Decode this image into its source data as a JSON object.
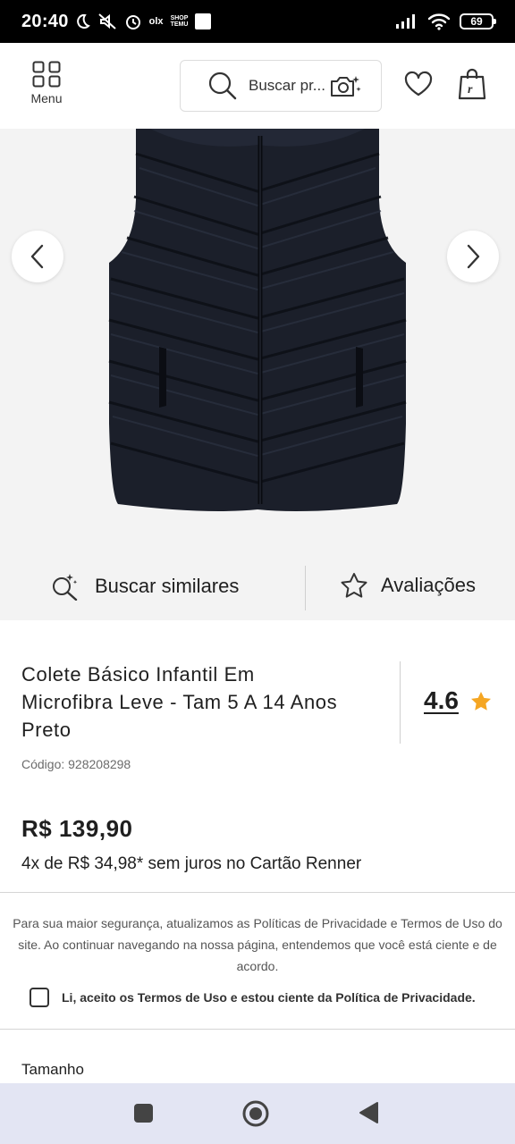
{
  "status_bar": {
    "time": "20:40",
    "olx": "olx",
    "temu_top": "SHOP",
    "temu_bottom": "TEMU",
    "battery": "69"
  },
  "header": {
    "menu_label": "Menu",
    "search_placeholder": "Buscar pr..."
  },
  "gallery": {
    "image_alt": "Colete preto acolchoado"
  },
  "actions": {
    "similar_label": "Buscar similares",
    "reviews_label": "Avaliações"
  },
  "product": {
    "title_line1": "Colete Básico Infantil Em",
    "title_line2": "Microfibra Leve - Tam 5 A 14 Anos",
    "title_line3": "Preto",
    "rating": "4.6",
    "code": "Código: 928208298",
    "price": "R$ 139,90",
    "installments": "4x de R$ 34,98* sem juros no Cartão Renner",
    "size_label": "Tamanho"
  },
  "privacy": {
    "text": "Para sua maior segurança, atualizamos as Políticas de Privacidade e Termos de Uso do site. Ao continuar navegando na nossa página, entendemos que você está ciente e de acordo.",
    "accept_label": "Li, aceito os Termos de Uso e estou ciente da Política de Privacidade."
  },
  "colors": {
    "star": "#f5a623",
    "vest": "#1b1f2a",
    "status_bar": "#000000",
    "nav_bar": "#e3e5f3"
  },
  "icons": {
    "menu": "grid-icon",
    "search": "search-icon",
    "camera": "camera-search-icon",
    "favorite": "heart-icon",
    "bag": "shopping-bag-icon",
    "prev": "chevron-left-icon",
    "next": "chevron-right-icon",
    "similar": "sparkle-search-icon",
    "reviews": "star-outline-icon",
    "rating_star": "star-filled-icon"
  }
}
